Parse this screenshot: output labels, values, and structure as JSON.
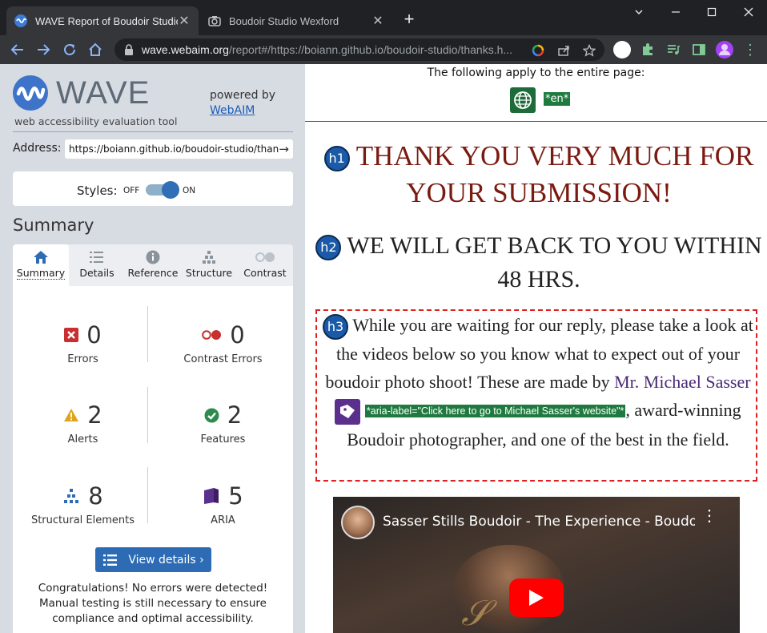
{
  "browser": {
    "tabs": [
      {
        "title": "WAVE Report of Boudoir Studio W",
        "active": true
      },
      {
        "title": "Boudoir Studio Wexford",
        "active": false
      }
    ],
    "url_host": "wave.webaim.org",
    "url_rest": "/report#/https://boiann.github.io/boudoir-studio/thanks.h..."
  },
  "wave": {
    "title": "WAVE",
    "subtitle": "web accessibility evaluation tool",
    "powered_by": "powered by",
    "powered_link": "WebAIM",
    "address_label": "Address:",
    "address_value": "https://boiann.github.io/boudoir-studio/than",
    "styles_label": "Styles:",
    "styles_off": "OFF",
    "styles_on": "ON",
    "styles_enabled": true,
    "summary_heading": "Summary",
    "tabs": [
      "Summary",
      "Details",
      "Reference",
      "Structure",
      "Contrast"
    ],
    "stats": [
      {
        "count": "0",
        "label": "Errors",
        "icon": "error-icon",
        "color": "#c7302f"
      },
      {
        "count": "0",
        "label": "Contrast Errors",
        "icon": "contrast-error-icon",
        "color": "#c7302f"
      },
      {
        "count": "2",
        "label": "Alerts",
        "icon": "alert-icon",
        "color": "#e0a31c"
      },
      {
        "count": "2",
        "label": "Features",
        "icon": "feature-icon",
        "color": "#2f8a4f"
      },
      {
        "count": "8",
        "label": "Structural Elements",
        "icon": "structure-icon",
        "color": "#2d6cb5"
      },
      {
        "count": "5",
        "label": "ARIA",
        "icon": "aria-icon",
        "color": "#5b2f8c"
      }
    ],
    "view_details": "View details ›",
    "congrats": "Congratulations! No errors were detected! Manual testing is still necessary to ensure compliance and optimal accessibility."
  },
  "preview": {
    "applies_text": "The following apply to the entire page:",
    "lang_tag": "*en*",
    "h1_badge": "h1",
    "h1_text": "THANK YOU VERY MUCH FOR YOUR SUBMISSION!",
    "h2_badge": "h2",
    "h2_text": "WE WILL GET BACK TO YOU WITHIN 48 HRS.",
    "h3_badge": "h3",
    "h3_text_before": "While you are waiting for our reply, please take a look at the videos below so you know what to expect out of your boudoir photo shoot! These are made by ",
    "h3_link": "Mr. Michael Sasser",
    "aria_label_tag": "*aria-label=\"Click here to go to Michael Sasser's website\"*",
    "h3_text_after": ", award-winning Boudoir photographer, and one of the best in the field.",
    "video_title": "Sasser Stills Boudoir - The Experience - Boudoi..."
  }
}
